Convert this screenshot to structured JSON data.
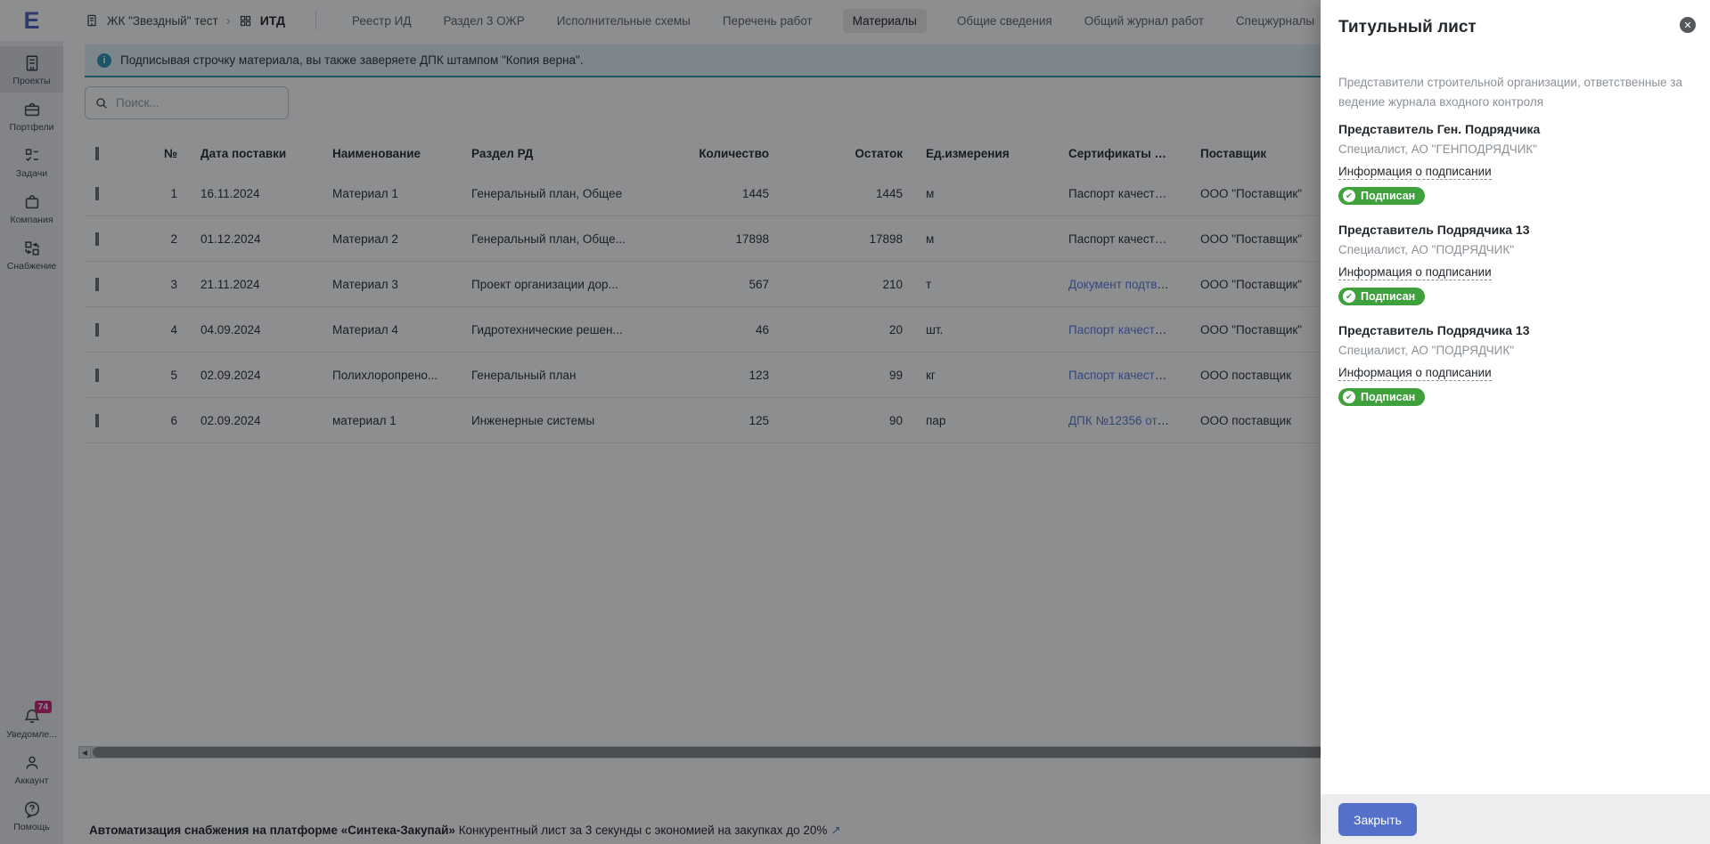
{
  "app": {
    "logo": "E"
  },
  "sidebar": {
    "items": [
      {
        "label": "Проекты"
      },
      {
        "label": "Портфели"
      },
      {
        "label": "Задачи"
      },
      {
        "label": "Компания"
      },
      {
        "label": "Снабжение"
      }
    ],
    "notifications": {
      "label": "Уведомле...",
      "badge": "74"
    },
    "account": {
      "label": "Аккаунт"
    },
    "help": {
      "label": "Помощь"
    }
  },
  "topbar": {
    "breadcrumb": {
      "project": "ЖК \"Звездный\" тест",
      "chevron": "›",
      "section": "ИТД"
    },
    "tabs": [
      {
        "label": "Реестр ИД"
      },
      {
        "label": "Раздел 3 ОЖР"
      },
      {
        "label": "Исполнительные схемы"
      },
      {
        "label": "Перечень работ"
      },
      {
        "label": "Материалы"
      },
      {
        "label": "Общие сведения"
      },
      {
        "label": "Общий журнал работ"
      },
      {
        "label": "Спецжурналы"
      }
    ],
    "active_tab": "Материалы"
  },
  "banner": {
    "icon": "i",
    "text": "Подписывая строчку материала, вы также заверяете ДПК штампом \"Копия верна\"."
  },
  "search": {
    "placeholder": "Поиск..."
  },
  "table": {
    "headers": {
      "num": "№",
      "date": "Дата поставки",
      "name": "Наименование",
      "section": "Раздел РД",
      "qty": "Количество",
      "rest": "Остаток",
      "unit": "Ед.измерения",
      "cert": "Сертификаты и па...",
      "supplier": "Поставщик"
    },
    "rows": [
      {
        "num": "1",
        "date": "16.11.2024",
        "name": "Материал 1",
        "section": "Генеральный план, Общее",
        "qty": "1445",
        "rest": "1445",
        "unit": "м",
        "cert": "Паспорт качества...",
        "supplier": "ООО \"Поставщик\""
      },
      {
        "num": "2",
        "date": "01.12.2024",
        "name": "Материал 2",
        "section": "Генеральный план, Обще...",
        "qty": "17898",
        "rest": "17898",
        "unit": "м",
        "cert": "Паспорт качества...",
        "supplier": "ООО \"Поставщик\""
      },
      {
        "num": "3",
        "date": "21.11.2024",
        "name": "Материал 3",
        "section": "Проект организации дор...",
        "qty": "567",
        "rest": "210",
        "unit": "т",
        "cert": "Документ подтве...",
        "supplier": "ООО \"Поставщик\""
      },
      {
        "num": "4",
        "date": "04.09.2024",
        "name": "Материал 4",
        "section": "Гидротехнические решен...",
        "qty": "46",
        "rest": "20",
        "unit": "шт.",
        "cert": "Паспорт качества...",
        "supplier": "ООО \"Поставщик\""
      },
      {
        "num": "5",
        "date": "02.09.2024",
        "name": "Полихлоропрено...",
        "section": "Генеральный план",
        "qty": "123",
        "rest": "99",
        "unit": "кг",
        "cert": "Паспорт качества...",
        "supplier": "ООО поставщик"
      },
      {
        "num": "6",
        "date": "02.09.2024",
        "name": "материал 1",
        "section": "Инженерные системы",
        "qty": "125",
        "rest": "90",
        "unit": "пар",
        "cert": "ДПК №12356 от 0...",
        "supplier": "ООО поставщик"
      }
    ]
  },
  "scrollbar": {
    "left_arrow": "◀"
  },
  "footer": {
    "bold": "Автоматизация снабжения на платформе «Синтека-Закупай»",
    "text": " Конкурентный лист за 3 секунды с экономией на закупках до 20%",
    "arrow": "↗"
  },
  "panel": {
    "title": "Титульный лист",
    "close_icon": "✕",
    "subtitle": "Представители строительной организации, ответственные за ведение журнала входного контроля",
    "representatives": [
      {
        "title": "Представитель Ген. Подрядчика",
        "role": "Специалист, АО \"ГЕНПОДРЯДЧИК\"",
        "link": "Информация о подписании",
        "status": "Подписан"
      },
      {
        "title": "Представитель Подрядчика 13",
        "role": "Специалист, АО \"ПОДРЯДЧИК\"",
        "link": "Информация о подписании",
        "status": "Подписан"
      },
      {
        "title": "Представитель Подрядчика 13",
        "role": "Специалист, АО \"ПОДРЯДЧИК\"",
        "link": "Информация о подписании",
        "status": "Подписан"
      }
    ],
    "check_glyph": "✔",
    "close_button": "Закрыть"
  },
  "colors": {
    "accent_blue": "#5470c8",
    "link_blue": "#587ae0",
    "badge_green": "#3fa13c",
    "notification_pink": "#cf1d79",
    "banner_teal": "#2f93b2",
    "logo_blue": "#4b5fc1"
  }
}
